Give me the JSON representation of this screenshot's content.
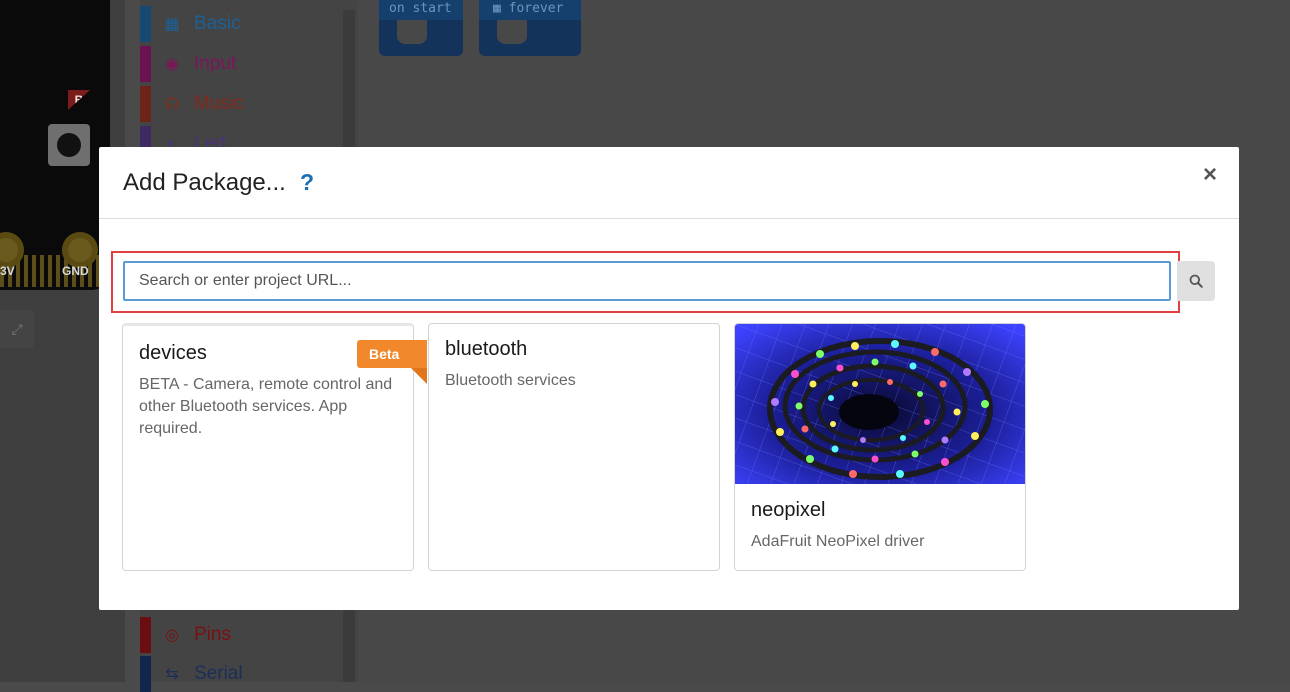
{
  "toolbox": {
    "items": [
      {
        "label": "Basic",
        "color": "#2a8fe0",
        "icon": "grid-icon"
      },
      {
        "label": "Input",
        "color": "#c2228e",
        "icon": "target-icon"
      },
      {
        "label": "Music",
        "color": "#d0402a",
        "icon": "headphones-icon"
      },
      {
        "label": "Led",
        "color": "#6a3fb3",
        "icon": "toggle-icon"
      },
      {
        "label": "Pins",
        "color": "#b3121d",
        "icon": "target-icon"
      },
      {
        "label": "Serial",
        "color": "#0f3d8c",
        "icon": "usb-icon"
      }
    ]
  },
  "workspace": {
    "blocks": [
      "on start",
      "forever"
    ]
  },
  "simulator": {
    "button_label": "B",
    "pins": [
      "3V",
      "GND"
    ]
  },
  "modal": {
    "title": "Add Package...",
    "help": "?",
    "close": "×",
    "search": {
      "placeholder": "Search or enter project URL...",
      "value": ""
    },
    "cards": [
      {
        "name": "devices",
        "description": "BETA - Camera, remote control and other Bluetooth services. App required.",
        "badge": "Beta"
      },
      {
        "name": "bluetooth",
        "description": "Bluetooth services"
      },
      {
        "name": "neopixel",
        "description": "AdaFruit NeoPixel driver"
      }
    ]
  },
  "colors": {
    "highlight": "#e04040",
    "input_border": "#5b9bd5",
    "help": "#1b6fb5",
    "badge": "#f2882c"
  }
}
